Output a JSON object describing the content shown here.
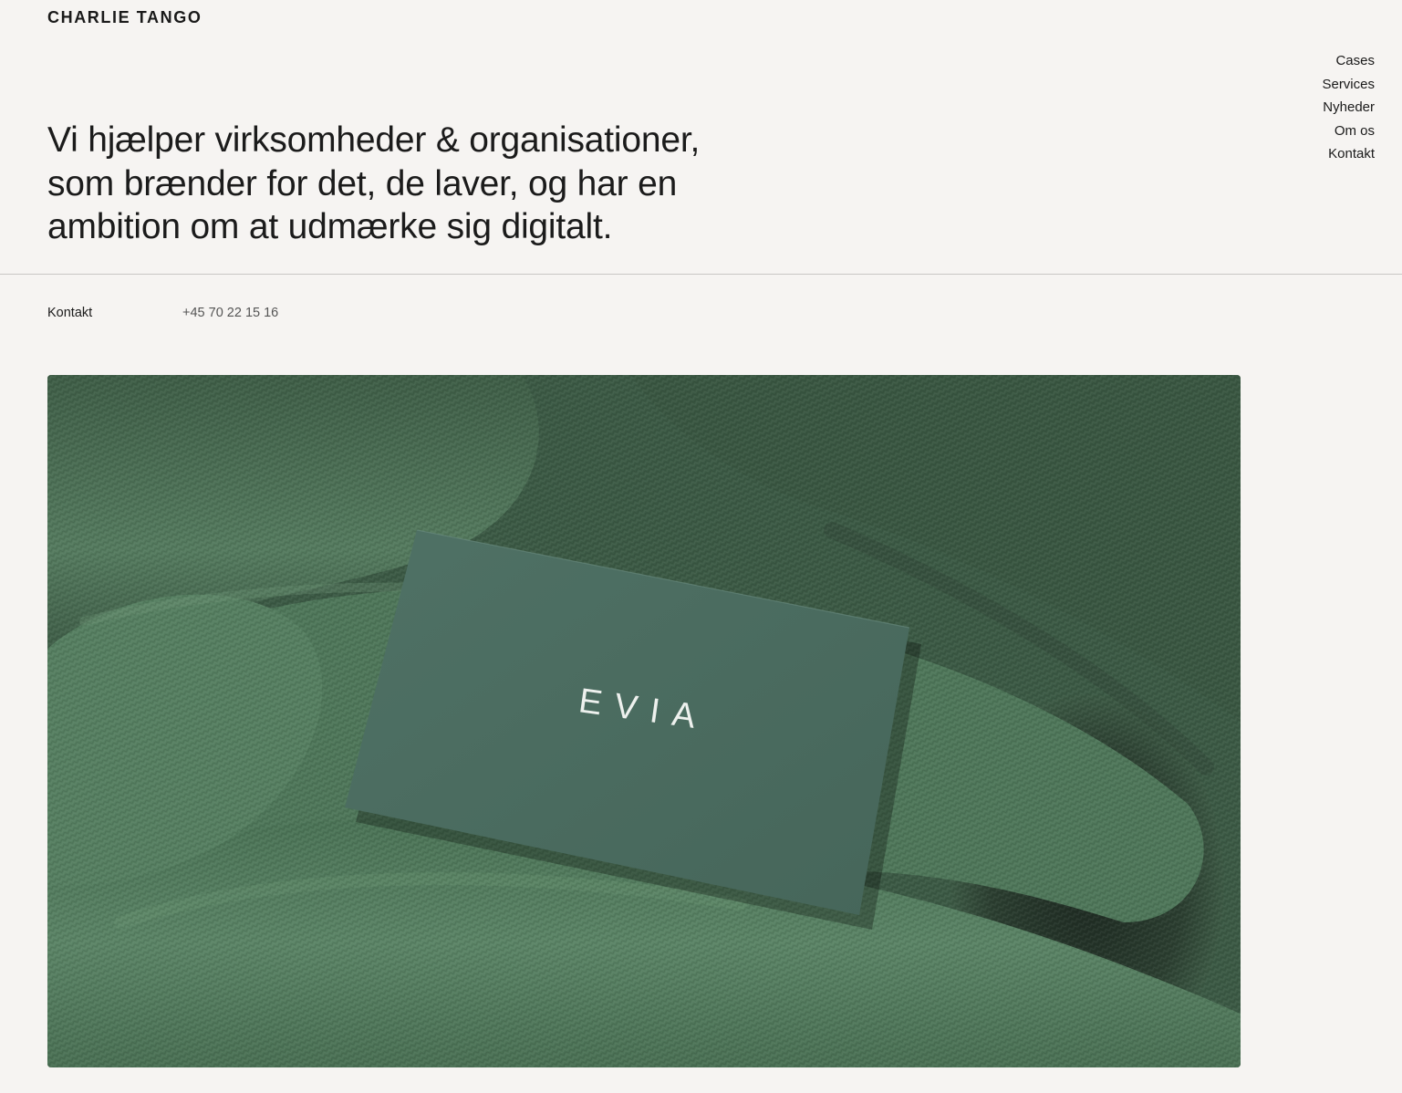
{
  "brand": {
    "logo": "CHARLIE TANGO"
  },
  "nav": {
    "items": [
      {
        "label": "Cases"
      },
      {
        "label": "Services"
      },
      {
        "label": "Nyheder"
      },
      {
        "label": "Om os"
      },
      {
        "label": "Kontakt"
      }
    ]
  },
  "hero": {
    "headline": "Vi hjælper virksomheder & organisationer, som brænder for det, de laver, og har en ambition om at udmærke sig digitalt."
  },
  "contact": {
    "label": "Kontakt",
    "phone": "+45 70 22 15 16"
  },
  "feature_image": {
    "card_text": "EVIA",
    "colors": {
      "fabric": "#4a7055",
      "fabric_shadow": "#2a3f30",
      "card": "#4d6e62"
    }
  }
}
